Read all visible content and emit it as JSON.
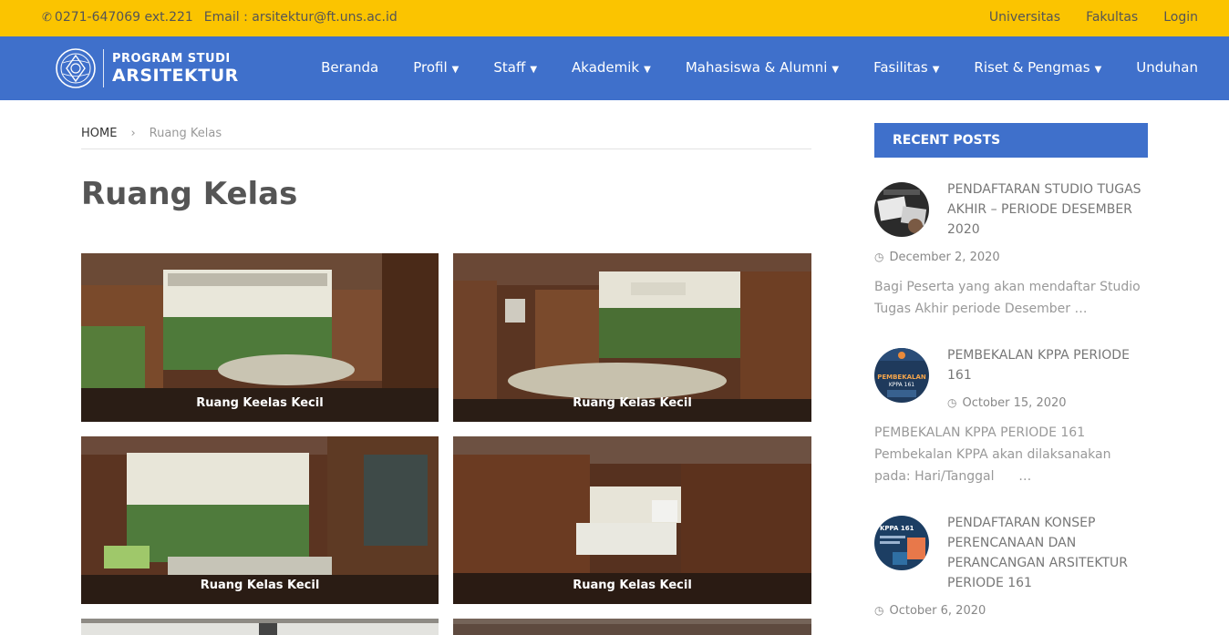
{
  "topbar": {
    "phone": "0271-647069 ext.221",
    "email": "Email : arsitektur@ft.uns.ac.id",
    "links": [
      "Universitas",
      "Fakultas",
      "Login"
    ]
  },
  "brand": {
    "line1": "PROGRAM STUDI",
    "line2": "ARSITEKTUR"
  },
  "nav": {
    "items": [
      {
        "label": "Beranda",
        "dropdown": false
      },
      {
        "label": "Profil",
        "dropdown": true
      },
      {
        "label": "Staff",
        "dropdown": true
      },
      {
        "label": "Akademik",
        "dropdown": true
      },
      {
        "label": "Mahasiswa & Alumni",
        "dropdown": true
      },
      {
        "label": "Fasilitas",
        "dropdown": true
      },
      {
        "label": "Riset & Pengmas",
        "dropdown": true
      },
      {
        "label": "Unduhan",
        "dropdown": false
      }
    ]
  },
  "breadcrumb": {
    "home": "HOME",
    "separator": "›",
    "current": "Ruang Kelas"
  },
  "page": {
    "title": "Ruang Kelas"
  },
  "gallery": [
    {
      "caption": "Ruang Keelas Kecil"
    },
    {
      "caption": "Ruang Kelas Kecil"
    },
    {
      "caption": "Ruang Kelas Kecil"
    },
    {
      "caption": "Ruang Kelas Kecil"
    }
  ],
  "sidebar": {
    "title": "RECENT POSTS",
    "posts": [
      {
        "title": "PENDAFTARAN STUDIO TUGAS AKHIR – PERIODE DESEMBER 2020",
        "date": "December 2, 2020",
        "excerpt": "Bagi Peserta yang akan mendaftar Studio Tugas Akhir periode Desember …"
      },
      {
        "title": "PEMBEKALAN KPPA PERIODE 161",
        "date": "October 15, 2020",
        "excerpt": "PEMBEKALAN KPPA PERIODE 161 Pembekalan KPPA akan dilaksanakan pada: Hari/Tanggal      …",
        "thumb_text1": "PEMBEKALAN",
        "thumb_text2": "KPPA 161"
      },
      {
        "title": "PENDAFTARAN KONSEP PERENCANAAN DAN PERANCANGAN ARSITEKTUR PERIODE 161",
        "date": "October 6, 2020",
        "thumb_text": "KPPA 161"
      }
    ]
  },
  "colors": {
    "topbar": "#fbc400",
    "nav": "#3f70cb",
    "accent": "#3f70cb"
  },
  "icons": {
    "phone": "phone-icon",
    "clock": "clock-icon",
    "caret": "caret-down-icon"
  }
}
